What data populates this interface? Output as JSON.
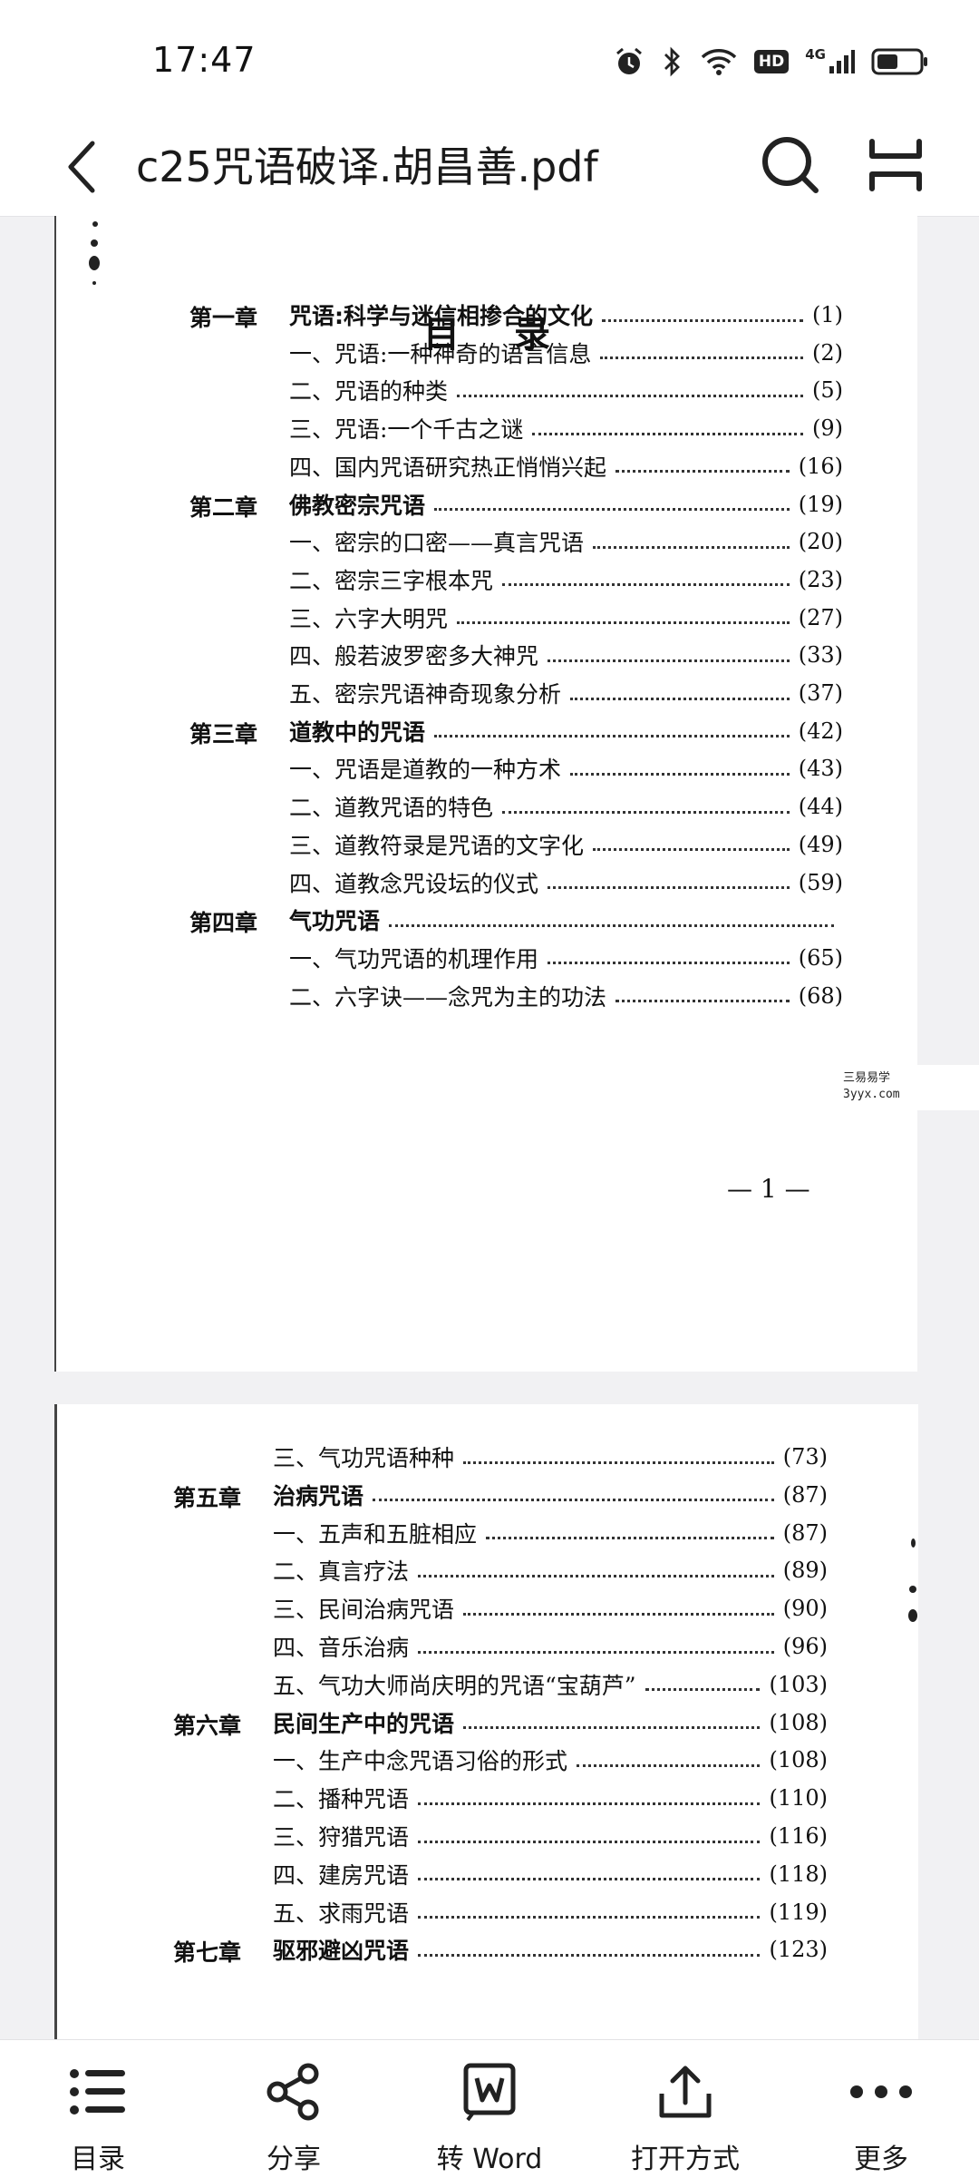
{
  "status_bar": {
    "time": "17:47",
    "hd": "HD",
    "network": "4G"
  },
  "title_bar": {
    "title": "c25咒语破译.胡昌善.pdf"
  },
  "page1": {
    "heading": "目录",
    "rows": [
      {
        "chapter": "第一章",
        "label": "咒语:科学与迷信相掺合的文化",
        "page": "(1)"
      },
      {
        "label": "一、咒语:一种神奇的语言信息",
        "page": "(2)"
      },
      {
        "label": "二、咒语的种类",
        "page": "(5)"
      },
      {
        "label": "三、咒语:一个千古之谜",
        "page": "(9)"
      },
      {
        "label": "四、国内咒语研究热正悄悄兴起",
        "page": "(16)"
      },
      {
        "chapter": "第二章",
        "label": "佛教密宗咒语",
        "page": "(19)"
      },
      {
        "label": "一、密宗的口密——真言咒语",
        "page": "(20)"
      },
      {
        "label": "二、密宗三字根本咒",
        "page": "(23)"
      },
      {
        "label": "三、六字大明咒",
        "page": "(27)"
      },
      {
        "label": "四、般若波罗密多大神咒",
        "page": "(33)"
      },
      {
        "label": "五、密宗咒语神奇现象分析",
        "page": "(37)"
      },
      {
        "chapter": "第三章",
        "label": "道教中的咒语",
        "page": "(42)"
      },
      {
        "label": "一、咒语是道教的一种方术",
        "page": "(43)"
      },
      {
        "label": "二、道教咒语的特色",
        "page": "(44)"
      },
      {
        "label": "三、道教符录是咒语的文字化",
        "page": "(49)"
      },
      {
        "label": "四、道教念咒设坛的仪式",
        "page": "(59)"
      },
      {
        "chapter": "第四章",
        "label": "气功咒语",
        "page": ""
      },
      {
        "label": "一、气功咒语的机理作用",
        "page": "(65)"
      },
      {
        "label": "二、六字诀——念咒为主的功法",
        "page": "(68)"
      }
    ],
    "page_number": "— 1 —",
    "watermark_line1": "三易易学",
    "watermark_line2": "3yyx.com"
  },
  "page2": {
    "rows": [
      {
        "label": "三、气功咒语种种",
        "page": "(73)"
      },
      {
        "chapter": "第五章",
        "label": "治病咒语",
        "page": "(87)"
      },
      {
        "label": "一、五声和五脏相应",
        "page": "(87)"
      },
      {
        "label": "二、真言疗法",
        "page": "(89)"
      },
      {
        "label": "三、民间治病咒语",
        "page": "(90)"
      },
      {
        "label": "四、音乐治病",
        "page": "(96)"
      },
      {
        "label": "五、气功大师尚庆明的咒语“宝葫芦”",
        "page": "(103)"
      },
      {
        "chapter": "第六章",
        "label": "民间生产中的咒语",
        "page": "(108)"
      },
      {
        "label": "一、生产中念咒语习俗的形式",
        "page": "(108)"
      },
      {
        "label": "二、播种咒语",
        "page": "(110)"
      },
      {
        "label": "三、狩猎咒语",
        "page": "(116)"
      },
      {
        "label": "四、建房咒语",
        "page": "(118)"
      },
      {
        "label": "五、求雨咒语",
        "page": "(119)"
      },
      {
        "chapter": "第七章",
        "label": "驱邪避凶咒语",
        "page": "(123)"
      }
    ]
  },
  "bottom_nav": {
    "items": [
      {
        "label": "目录",
        "icon": "list-icon"
      },
      {
        "label": "分享",
        "icon": "share-icon"
      },
      {
        "label": "转 Word",
        "icon": "word-icon"
      },
      {
        "label": "打开方式",
        "icon": "upload-icon"
      },
      {
        "label": "更多",
        "icon": "more-icon"
      }
    ]
  }
}
